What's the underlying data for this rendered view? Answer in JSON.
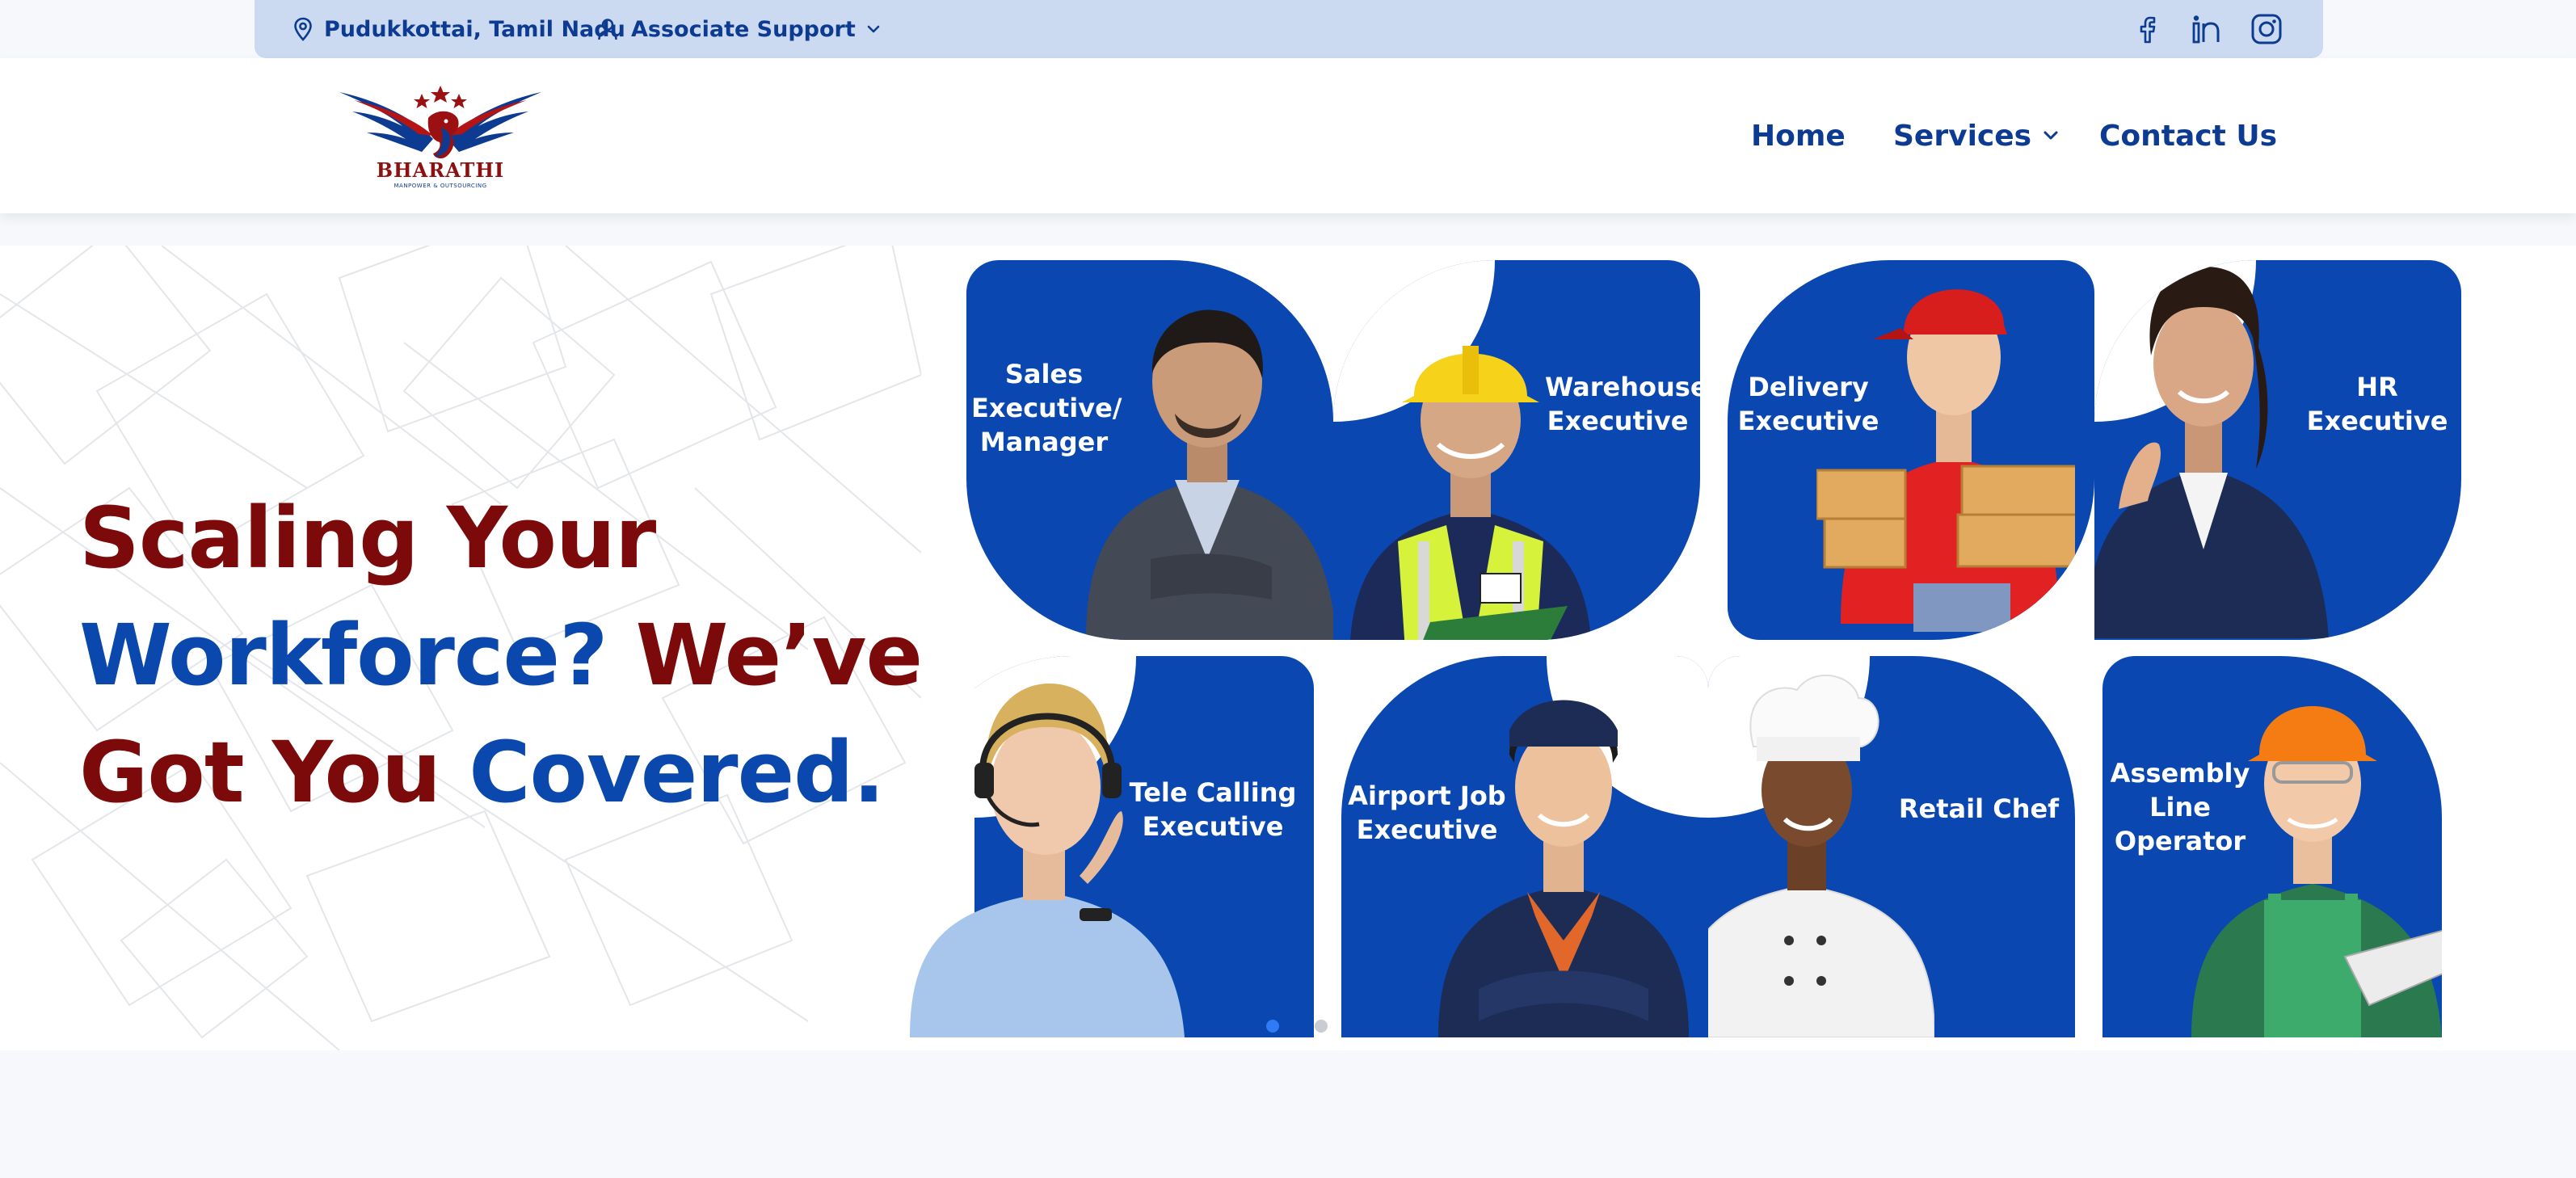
{
  "topbar": {
    "location": "Pudukkottai, Tamil Nadu",
    "support": "Associate Support",
    "icons": [
      "location-pin-icon",
      "user-icon",
      "chevron-down-icon",
      "facebook-icon",
      "linkedin-icon",
      "instagram-icon"
    ]
  },
  "brand": {
    "name": "BHARATHI",
    "tagline": "MANPOWER & OUTSOURCING"
  },
  "nav": {
    "home": "Home",
    "services": "Services",
    "contact": "Contact Us"
  },
  "hero": {
    "headline": {
      "l1": "Scaling Your",
      "l2a": "Workforce?",
      "l2b": "We’ve",
      "l3a": "Got You",
      "l3b": "Covered."
    },
    "cards": {
      "sales": "Sales Executive/ Manager",
      "warehouse": "Warehouse Executive",
      "delivery": "Delivery Executive",
      "hr": "HR Executive",
      "tele": "Tele Calling Executive",
      "airport": "Airport Job Executive",
      "chef": "Retail Chef",
      "assembly": "Assembly Line Operator"
    },
    "carousel": {
      "slides": 4,
      "active": 2
    }
  },
  "colors": {
    "brand_blue": "#0a47b0",
    "brand_red": "#7d0a0a",
    "topbar_bg": "#cbdaf1",
    "nav_text": "#0d3b91"
  }
}
